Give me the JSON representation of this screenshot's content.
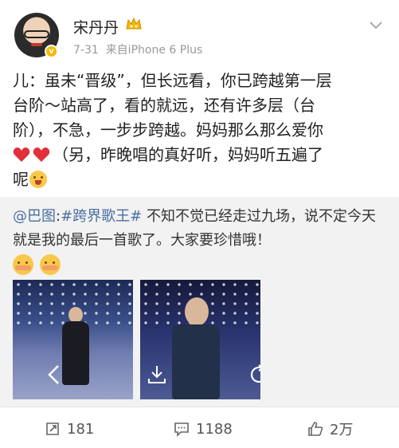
{
  "user": {
    "name": "宋丹丹",
    "date": "7-31",
    "source": "来自iPhone 6 Plus",
    "verified_badge": "v"
  },
  "post": {
    "line1": "儿：虽未“晋级”，但长远看，你已跨越第一层",
    "line2": "台阶～站高了，看的就远，还有许多层（台",
    "line3": "阶），不急，一步步跨越。妈妈那么那么爱你",
    "line4": "（另，昨晚唱的真好听，妈妈听五遍了",
    "line5": "呢"
  },
  "repost": {
    "mention": "@巴图",
    "colon": ":",
    "topic": "#跨界歌王#",
    "text": " 不知不觉已经走过九场，说不定今天就是我的最后一首歌了。大家要珍惜哦！"
  },
  "actions": {
    "repost_count": "181",
    "comment_count": "1188",
    "like_count": "2万"
  },
  "colors": {
    "link": "#4a6ea0",
    "badge": "#f6b900",
    "heart": "#e0303a"
  },
  "icons": [
    "crown-icon",
    "chevron-down-icon",
    "heart-icon",
    "prev-arrow-icon",
    "download-icon",
    "refresh-icon",
    "repost-icon",
    "comment-icon",
    "like-icon"
  ]
}
